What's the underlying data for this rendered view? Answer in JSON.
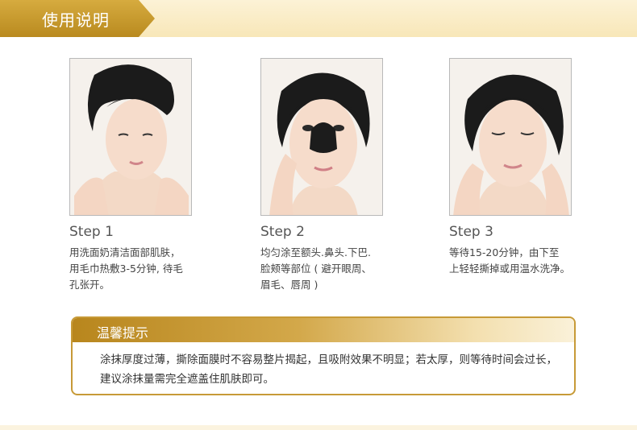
{
  "header": {
    "title": "使用说明"
  },
  "steps": [
    {
      "title": "Step 1",
      "desc": "用洗面奶清洁面部肌肤，\n用毛巾热敷3-5分钟, 待毛\n孔张开。"
    },
    {
      "title": "Step 2",
      "desc": "均匀涂至额头.鼻头.下巴.\n脸颊等部位 ( 避开眼周、\n眉毛、唇周 )"
    },
    {
      "title": "Step 3",
      "desc": "等待15-20分钟，由下至\n上轻轻撕掉或用温水洗净。"
    }
  ],
  "tip": {
    "title": "温馨提示",
    "text": "涂抹厚度过薄，撕除面膜时不容易整片揭起，且吸附效果不明显；若太厚，则等待时间会过长，建议涂抹量需完全遮盖住肌肤即可。"
  },
  "colors": {
    "gold": "#c79a37",
    "banner_bg": "#fcf2d6"
  }
}
